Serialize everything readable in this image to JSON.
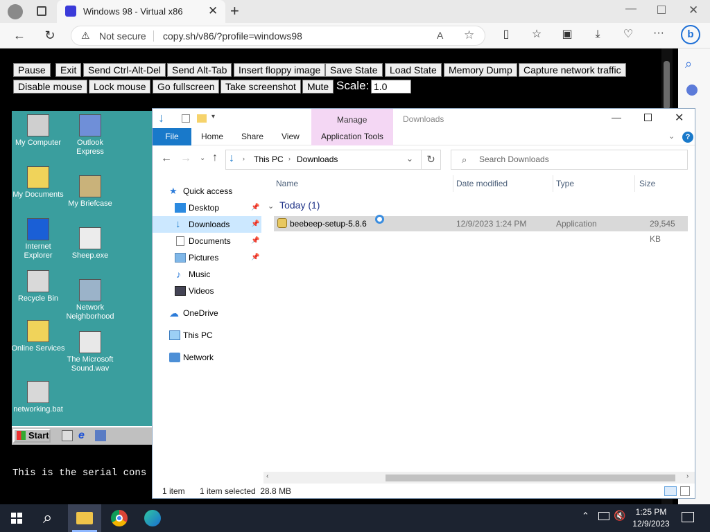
{
  "browser": {
    "tab_title": "Windows 98 - Virtual x86",
    "security": "Not secure",
    "url": "copy.sh/v86/?profile=windows98"
  },
  "v86": {
    "buttons_row1": [
      "Pause",
      "Exit",
      "Send Ctrl-Alt-Del",
      "Send Alt-Tab",
      "Insert floppy image",
      "Save State",
      "Load State",
      "Memory Dump",
      "Capture network traffic"
    ],
    "buttons_row2": [
      "Disable mouse",
      "Lock mouse",
      "Go fullscreen",
      "Take screenshot",
      "Mute"
    ],
    "scale_label": "Scale:",
    "scale_value": "1.0",
    "serial_text": "This is the serial cons"
  },
  "win98": {
    "icons": [
      "My Computer",
      "Outlook Express",
      "My Documents",
      "My Briefcase",
      "Internet Explorer",
      "Sheep.exe",
      "Recycle Bin",
      "Network Neighborhood",
      "Online Services",
      "The Microsoft Sound.wav",
      "networking.bat"
    ],
    "start_label": "Start"
  },
  "explorer": {
    "title": "Downloads",
    "contextual_header": "Manage",
    "ribbon_tabs": [
      "File",
      "Home",
      "Share",
      "View",
      "Application Tools"
    ],
    "breadcrumb": [
      "This PC",
      "Downloads"
    ],
    "search_placeholder": "Search Downloads",
    "nav": {
      "quick_access": "Quick access",
      "desktop": "Desktop",
      "downloads": "Downloads",
      "documents": "Documents",
      "pictures": "Pictures",
      "music": "Music",
      "videos": "Videos",
      "onedrive": "OneDrive",
      "this_pc": "This PC",
      "network": "Network"
    },
    "columns": [
      "Name",
      "Date modified",
      "Type",
      "Size"
    ],
    "group": "Today (1)",
    "file": {
      "name": "beebeep-setup-5.8.6",
      "date": "12/9/2023 1:24 PM",
      "type": "Application",
      "size": "29,545 KB"
    },
    "status_count": "1 item",
    "status_selected": "1 item selected  28.8 MB"
  },
  "taskbar": {
    "time": "1:25 PM",
    "date": "12/9/2023"
  },
  "colors": {
    "file_tab": "#1979ca",
    "manage": "#f4d7f4",
    "desktop98": "#3a9e9e",
    "taskbar": "#1c2330"
  }
}
